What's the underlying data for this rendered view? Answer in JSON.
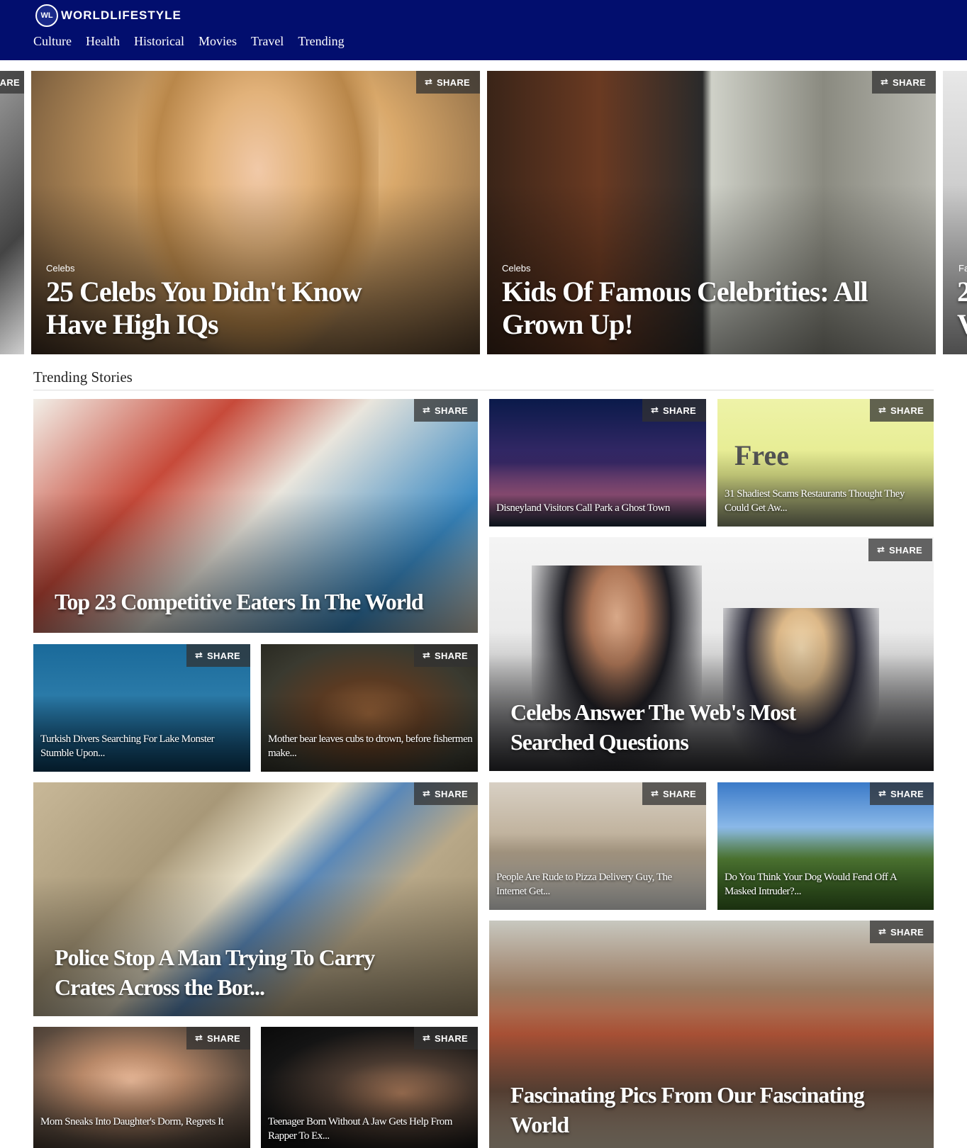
{
  "header": {
    "logo_badge": "WL",
    "logo_text": "WORLDLIFESTYLE",
    "nav": [
      "Culture",
      "Health",
      "Historical",
      "Movies",
      "Travel",
      "Trending"
    ]
  },
  "share_label": "SHARE",
  "carousel": {
    "left_partial_share": "ARE",
    "right_partial_text": [
      "Fa",
      "2",
      "V"
    ],
    "slides": [
      {
        "category": "Celebs",
        "title": "25 Celebs You Didn't Know Have High IQs"
      },
      {
        "category": "Celebs",
        "title": "Kids Of Famous Celebrities: All Grown Up!"
      }
    ]
  },
  "trending": {
    "heading": "Trending Stories",
    "stories": [
      {
        "title": "Top 23 Competitive Eaters In The World"
      },
      {
        "title": "Disneyland Visitors Call Park a Ghost Town"
      },
      {
        "title": "31 Shadiest Scams Restaurants Thought They Could Get Aw..."
      },
      {
        "title": "Celebs Answer The Web's Most Searched Questions"
      },
      {
        "title": "Turkish Divers Searching For Lake Monster Stumble Upon..."
      },
      {
        "title": "Mother bear leaves cubs to drown, before fishermen make..."
      },
      {
        "title": "Police Stop A Man Trying To Carry Crates Across the Bor..."
      },
      {
        "title": "People Are Rude to Pizza Delivery Guy, The Internet Get..."
      },
      {
        "title": "Do You Think Your Dog Would Fend Off A Masked Intruder?..."
      },
      {
        "title": "Fascinating Pics From Our Fascinating World"
      },
      {
        "title": "Mom Sneaks Into Daughter's Dorm, Regrets It"
      },
      {
        "title": "Teenager Born Without A Jaw Gets Help From Rapper To Ex..."
      }
    ]
  },
  "image_text": {
    "free_sign": "Free"
  }
}
